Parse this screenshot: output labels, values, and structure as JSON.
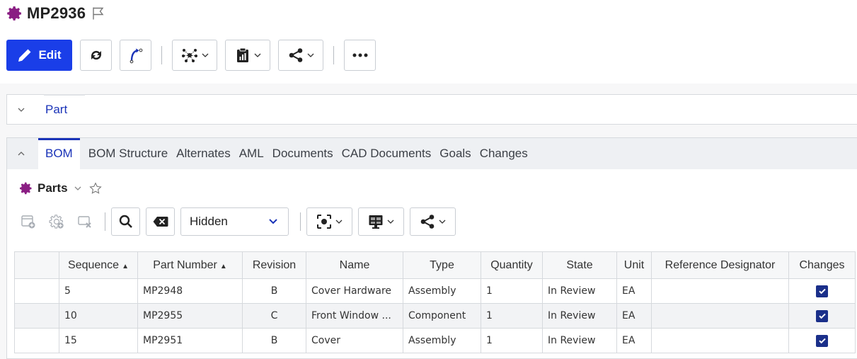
{
  "header": {
    "title": "MP2936",
    "accent_color": "#8a1e83"
  },
  "toolbar": {
    "edit_label": "Edit",
    "icons": [
      "pencil-icon",
      "refresh-icon",
      "lifecycle-icon",
      "network-icon",
      "clipboard-report-icon",
      "share-icon",
      "more-icon"
    ]
  },
  "part_section": {
    "label": "Part"
  },
  "tabs": [
    {
      "label": "BOM",
      "active": true
    },
    {
      "label": "BOM Structure",
      "active": false
    },
    {
      "label": "Alternates",
      "active": false
    },
    {
      "label": "AML",
      "active": false
    },
    {
      "label": "Documents",
      "active": false
    },
    {
      "label": "CAD Documents",
      "active": false
    },
    {
      "label": "Goals",
      "active": false
    },
    {
      "label": "Changes",
      "active": false
    }
  ],
  "parts_panel": {
    "label": "Parts",
    "view_select": "Hidden"
  },
  "table": {
    "columns": [
      "Sequence",
      "Part Number",
      "Revision",
      "Name",
      "Type",
      "Quantity",
      "State",
      "Unit",
      "Reference Designator",
      "Changes"
    ],
    "sorted_columns": [
      "Sequence",
      "Part Number"
    ],
    "rows": [
      {
        "sequence": "5",
        "part_number": "MP2948",
        "revision": "B",
        "name": "Cover Hardware",
        "type": "Assembly",
        "quantity": "1",
        "state": "In Review",
        "unit": "EA",
        "ref_designator": "",
        "changes": true
      },
      {
        "sequence": "10",
        "part_number": "MP2955",
        "revision": "C",
        "name": "Front Window ...",
        "type": "Component",
        "quantity": "1",
        "state": "In Review",
        "unit": "EA",
        "ref_designator": "",
        "changes": true
      },
      {
        "sequence": "15",
        "part_number": "MP2951",
        "revision": "B",
        "name": "Cover",
        "type": "Assembly",
        "quantity": "1",
        "state": "In Review",
        "unit": "EA",
        "ref_designator": "",
        "changes": true
      }
    ]
  }
}
